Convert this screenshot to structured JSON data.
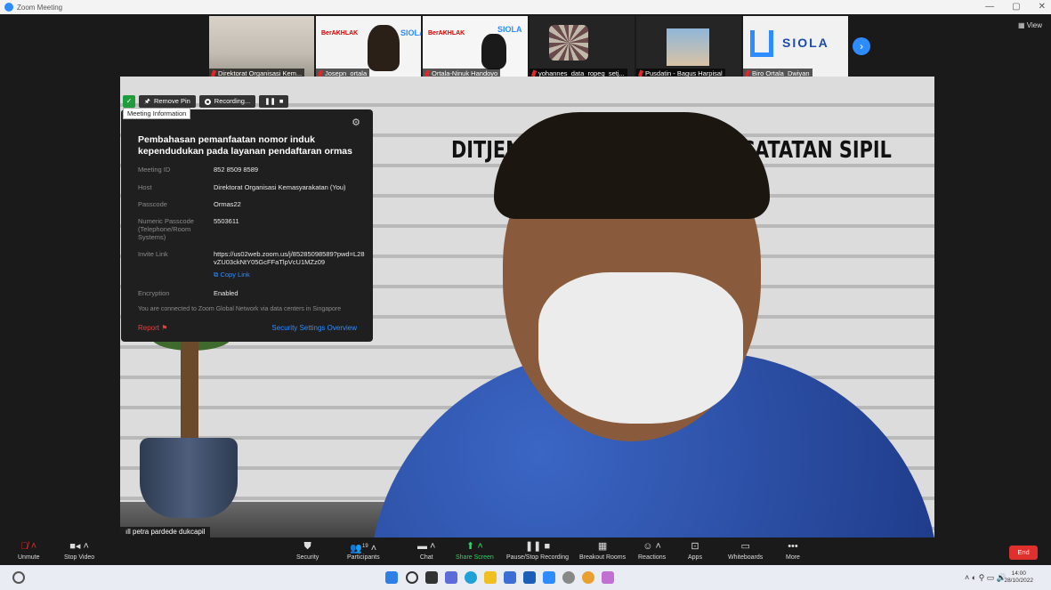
{
  "window": {
    "title": "Zoom Meeting",
    "controls": [
      "—",
      "▢",
      "✕"
    ]
  },
  "view_label": "View",
  "gallery": [
    {
      "name": "Direktorat Organisasi Kem..."
    },
    {
      "name": "Josepn_ortala"
    },
    {
      "name": "Ortala-Ninuk Handoyo"
    },
    {
      "name": "yohannes_data_ropeg_setj..."
    },
    {
      "name": "Pusdatin - Bagus Harpisal"
    },
    {
      "name": "Biro Ortala_Dwiyan"
    }
  ],
  "thumb_text": {
    "berakhlak": "BerAKHLAK",
    "siola": "SIOLA"
  },
  "main_video": {
    "wall_left": "DITJEN",
    "wall_right": "ICATATAN SIPIL",
    "speaker_label": "petra pardede dukcapil"
  },
  "pinbar": {
    "remove_pin": "Remove Pin",
    "recording": "Recording..."
  },
  "meeting_info": {
    "tooltip": "Meeting Information",
    "title": "Pembahasan pemanfaatan nomor induk kependudukan pada layanan pendaftaran ormas",
    "rows": [
      {
        "k": "Meeting ID",
        "v": "852 8509 8589"
      },
      {
        "k": "Host",
        "v": "Direktorat Organisasi Kemasyarakatan (You)"
      },
      {
        "k": "Passcode",
        "v": "Ormas22"
      },
      {
        "k": "Numeric Passcode (Telephone/Room Systems)",
        "v": "5503611"
      },
      {
        "k": "Invite Link",
        "v": "https://us02web.zoom.us/j/85285098589?pwd=L28vZU03ckNtY05GcFFaTlpVcU1MZz09"
      },
      {
        "k": "Encryption",
        "v": "Enabled"
      }
    ],
    "copy_link": "Copy Link",
    "global_network": "You are connected to Zoom Global Network via data centers in Singapore",
    "report": "Report",
    "security_overview": "Security Settings Overview"
  },
  "toolbar": {
    "unmute": "Unmute",
    "stop_video": "Stop Video",
    "security": "Security",
    "participants": "Participants",
    "participants_count": "19",
    "chat": "Chat",
    "share_screen": "Share Screen",
    "pause_recording": "Pause/Stop Recording",
    "breakout": "Breakout Rooms",
    "reactions": "Reactions",
    "apps": "Apps",
    "whiteboards": "Whiteboards",
    "more": "More",
    "end": "End"
  },
  "taskbar": {
    "time": "14:00",
    "date": "28/10/2022"
  },
  "colors": {
    "zoom_blue": "#2d8cff",
    "end_red": "#e0302d",
    "share_green": "#23d959",
    "shield_green": "#1f9d3d"
  }
}
